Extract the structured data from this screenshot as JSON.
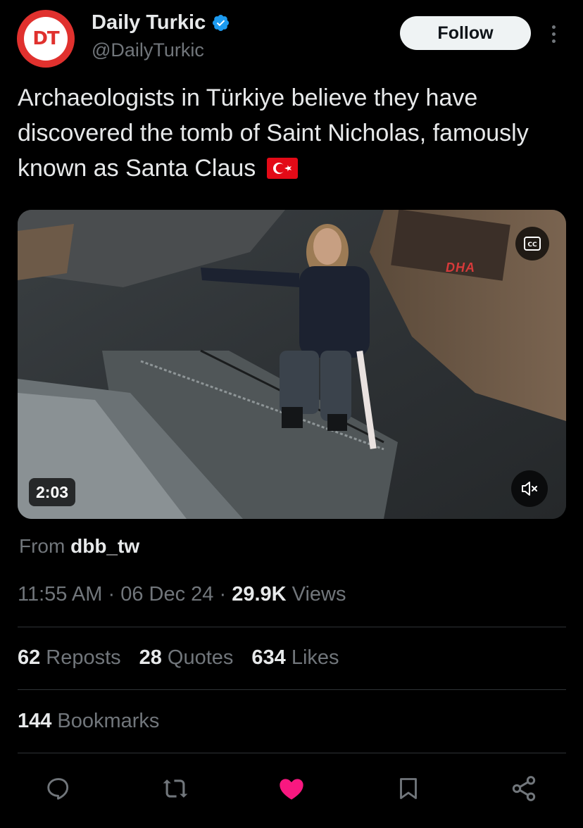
{
  "author": {
    "avatar_text": "DT",
    "display_name": "Daily Turkic",
    "handle": "@DailyTurkic",
    "verified": true
  },
  "follow_label": "Follow",
  "tweet_text": "Archaeologists in Türkiye believe they have discovered the tomb of Saint Nicholas, famously known as Santa Claus",
  "media": {
    "duration": "2:03",
    "watermark": "DHA",
    "captions_icon": "closed-captions-icon",
    "mute_icon": "volume-muted-icon"
  },
  "source": {
    "prefix": "From",
    "account": "dbb_tw"
  },
  "meta": {
    "time": "11:55 AM",
    "separator": "·",
    "date": "06 Dec 24",
    "views_count": "29.9K",
    "views_label": "Views"
  },
  "stats": {
    "reposts_count": "62",
    "reposts_label": "Reposts",
    "quotes_count": "28",
    "quotes_label": "Quotes",
    "likes_count": "634",
    "likes_label": "Likes",
    "bookmarks_count": "144",
    "bookmarks_label": "Bookmarks"
  },
  "actions": [
    "reply-icon",
    "repost-icon",
    "like-icon",
    "bookmark-icon",
    "share-icon"
  ],
  "colors": {
    "background": "#000000",
    "text_primary": "#e7e9ea",
    "text_secondary": "#71767b",
    "verified_blue": "#1d9bf0",
    "like_pink": "#f91880",
    "avatar_red": "#e0312e"
  }
}
